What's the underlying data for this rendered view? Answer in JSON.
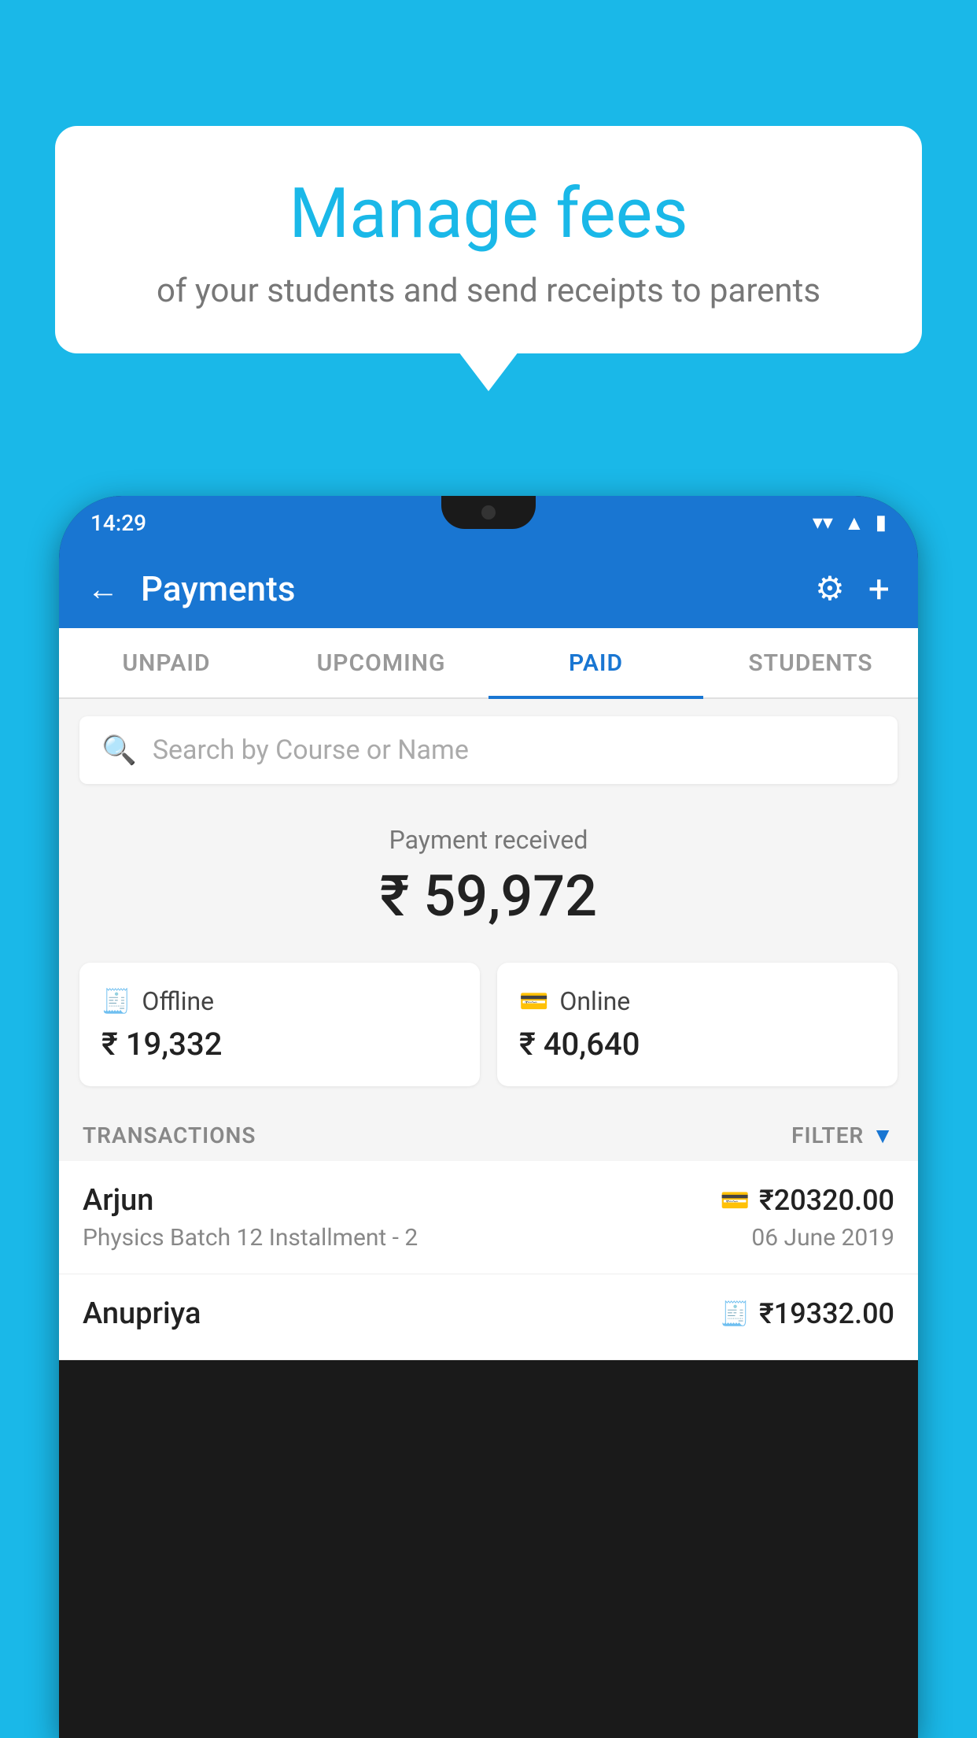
{
  "background": {
    "color": "#1ab8e8"
  },
  "speech_bubble": {
    "title": "Manage fees",
    "subtitle": "of your students and send receipts to parents"
  },
  "phone": {
    "status_bar": {
      "time": "14:29"
    },
    "header": {
      "title": "Payments",
      "back_label": "←",
      "gear_label": "⚙",
      "plus_label": "+"
    },
    "tabs": [
      {
        "label": "UNPAID",
        "active": false
      },
      {
        "label": "UPCOMING",
        "active": false
      },
      {
        "label": "PAID",
        "active": true
      },
      {
        "label": "STUDENTS",
        "active": false
      }
    ],
    "search": {
      "placeholder": "Search by Course or Name"
    },
    "payment_summary": {
      "label": "Payment received",
      "amount": "₹ 59,972"
    },
    "payment_cards": [
      {
        "label": "Offline",
        "amount": "₹ 19,332",
        "icon": "offline"
      },
      {
        "label": "Online",
        "amount": "₹ 40,640",
        "icon": "online"
      }
    ],
    "transactions": {
      "header": "TRANSACTIONS",
      "filter_label": "FILTER",
      "rows": [
        {
          "name": "Arjun",
          "course": "Physics Batch 12 Installment - 2",
          "amount": "₹20320.00",
          "date": "06 June 2019",
          "icon": "card"
        },
        {
          "name": "Anupriya",
          "course": "",
          "amount": "₹19332.00",
          "date": "",
          "icon": "offline"
        }
      ]
    }
  }
}
